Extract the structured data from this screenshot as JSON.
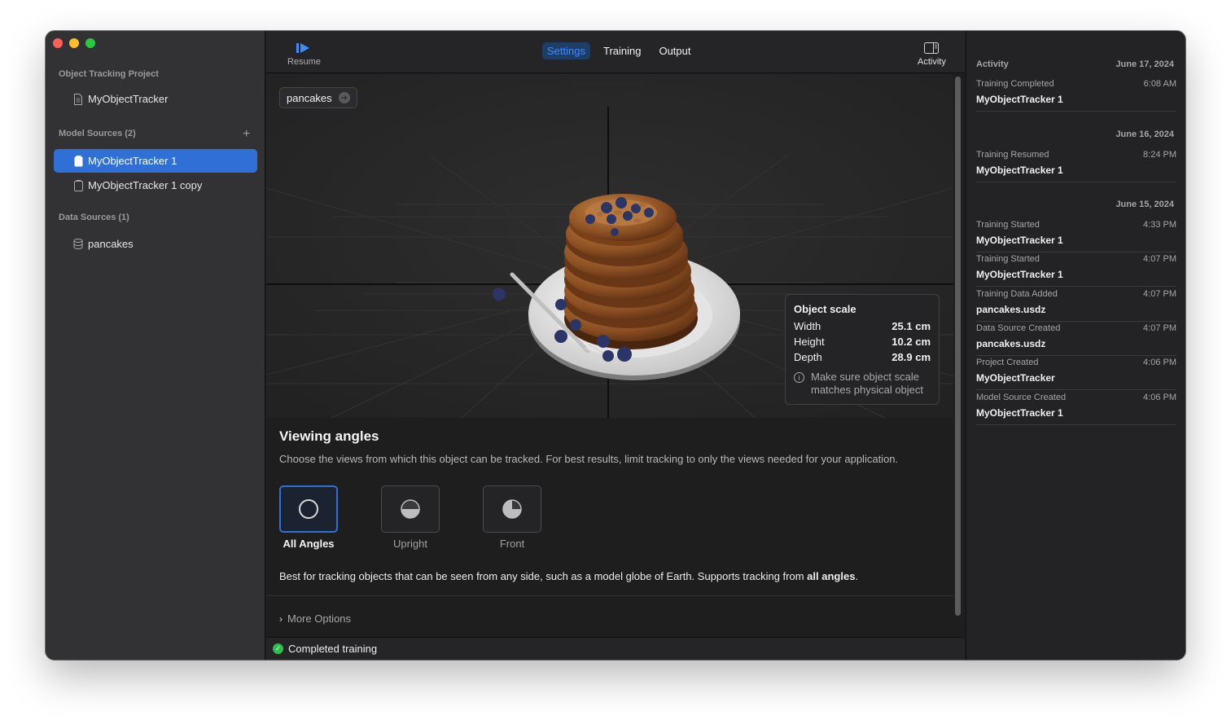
{
  "sidebar": {
    "project_section": "Object Tracking Project",
    "project_item": "MyObjectTracker",
    "model_section": "Model Sources (2)",
    "add_symbol": "+",
    "model_items": [
      "MyObjectTracker 1",
      "MyObjectTracker 1 copy"
    ],
    "data_section": "Data Sources (1)",
    "data_items": [
      "pancakes"
    ]
  },
  "toolbar": {
    "resume_label": "Resume",
    "activity_label": "Activity",
    "tabs": [
      "Settings",
      "Training",
      "Output"
    ],
    "active_tab": "Settings"
  },
  "viewport": {
    "chip_label": "pancakes",
    "chip_icon": "arrow-circle-icon",
    "object_scale": {
      "title": "Object scale",
      "rows": [
        {
          "label": "Width",
          "value": "25.1 cm"
        },
        {
          "label": "Height",
          "value": "10.2 cm"
        },
        {
          "label": "Depth",
          "value": "28.9 cm"
        }
      ],
      "note": "Make sure object scale matches physical object"
    }
  },
  "angles": {
    "title": "Viewing angles",
    "description": "Choose the views from which this object can be tracked. For best results, limit tracking to only the views needed for your application.",
    "options": [
      "All Angles",
      "Upright",
      "Front"
    ],
    "selected": "All Angles",
    "note_prefix": "Best for tracking objects that can be seen from any side, such as a model globe of Earth. Supports tracking from ",
    "note_bold": "all angles",
    "note_suffix": "."
  },
  "more_options": "More Options",
  "status": "Completed training",
  "activity": {
    "header": "Activity",
    "days": [
      {
        "date": "June 17, 2024",
        "entries": [
          {
            "event": "Training Completed",
            "time": "6:08 AM",
            "name": "MyObjectTracker 1"
          }
        ]
      },
      {
        "date": "June 16, 2024",
        "entries": [
          {
            "event": "Training Resumed",
            "time": "8:24 PM",
            "name": "MyObjectTracker 1"
          }
        ]
      },
      {
        "date": "June 15, 2024",
        "entries": [
          {
            "event": "Training Started",
            "time": "4:33 PM",
            "name": "MyObjectTracker 1"
          },
          {
            "event": "Training Started",
            "time": "4:07 PM",
            "name": "MyObjectTracker 1"
          },
          {
            "event": "Training Data Added",
            "time": "4:07 PM",
            "name": "pancakes.usdz"
          },
          {
            "event": "Data Source Created",
            "time": "4:07 PM",
            "name": "pancakes.usdz"
          },
          {
            "event": "Project Created",
            "time": "4:06 PM",
            "name": "MyObjectTracker"
          },
          {
            "event": "Model Source Created",
            "time": "4:06 PM",
            "name": "MyObjectTracker 1"
          }
        ]
      }
    ]
  },
  "colors": {
    "accent": "#2f6fd6",
    "tab_active_text": "#3c8cff",
    "status_ok": "#2fbe4a",
    "window_bg": "#1e1e1e",
    "sidebar_bg": "#323235"
  }
}
